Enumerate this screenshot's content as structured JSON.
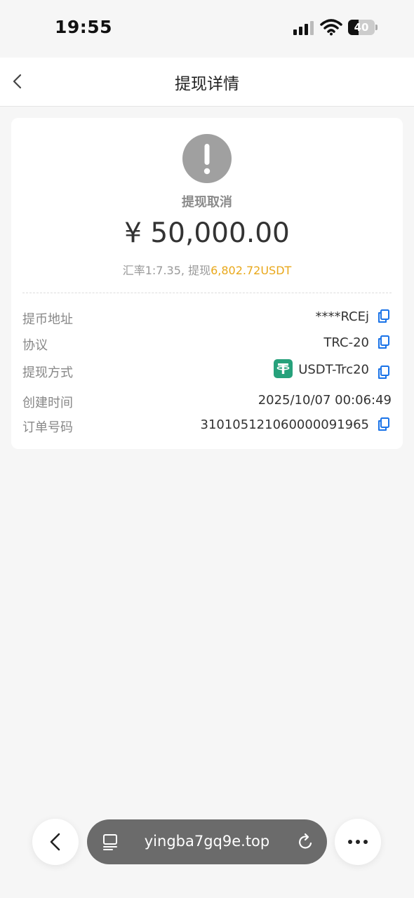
{
  "status_bar": {
    "time": "19:55",
    "battery": "40",
    "battery_level_percent": 40
  },
  "nav": {
    "title": "提现详情"
  },
  "summary": {
    "status": "提现取消",
    "amount": "¥ 50,000.00",
    "rate_prefix": "汇率1:7.35, 提现",
    "rate_usdt": "6,802.72USDT"
  },
  "details": [
    {
      "label": "提币地址",
      "value": "****RCEj"
    },
    {
      "label": "协议",
      "value": "TRC-20"
    },
    {
      "label": "提现方式",
      "value": "USDT-Trc20"
    },
    {
      "label": "创建时间",
      "value": "2025/10/07 00:06:49"
    },
    {
      "label": "订单号码",
      "value": "310105121060000091965"
    }
  ],
  "browser": {
    "url": "yingba7gq9e.top"
  },
  "colors": {
    "accent_blue": "#1a73e8",
    "usdt_orange": "#e9a81b",
    "tether_green": "#26a17b",
    "status_gray": "#a0a0a0"
  },
  "icons": [
    "signal-icon",
    "wifi-icon",
    "battery-icon",
    "back-icon",
    "exclamation-icon",
    "copy-icon",
    "tether-icon",
    "tabs-icon",
    "reload-icon",
    "more-icon"
  ]
}
